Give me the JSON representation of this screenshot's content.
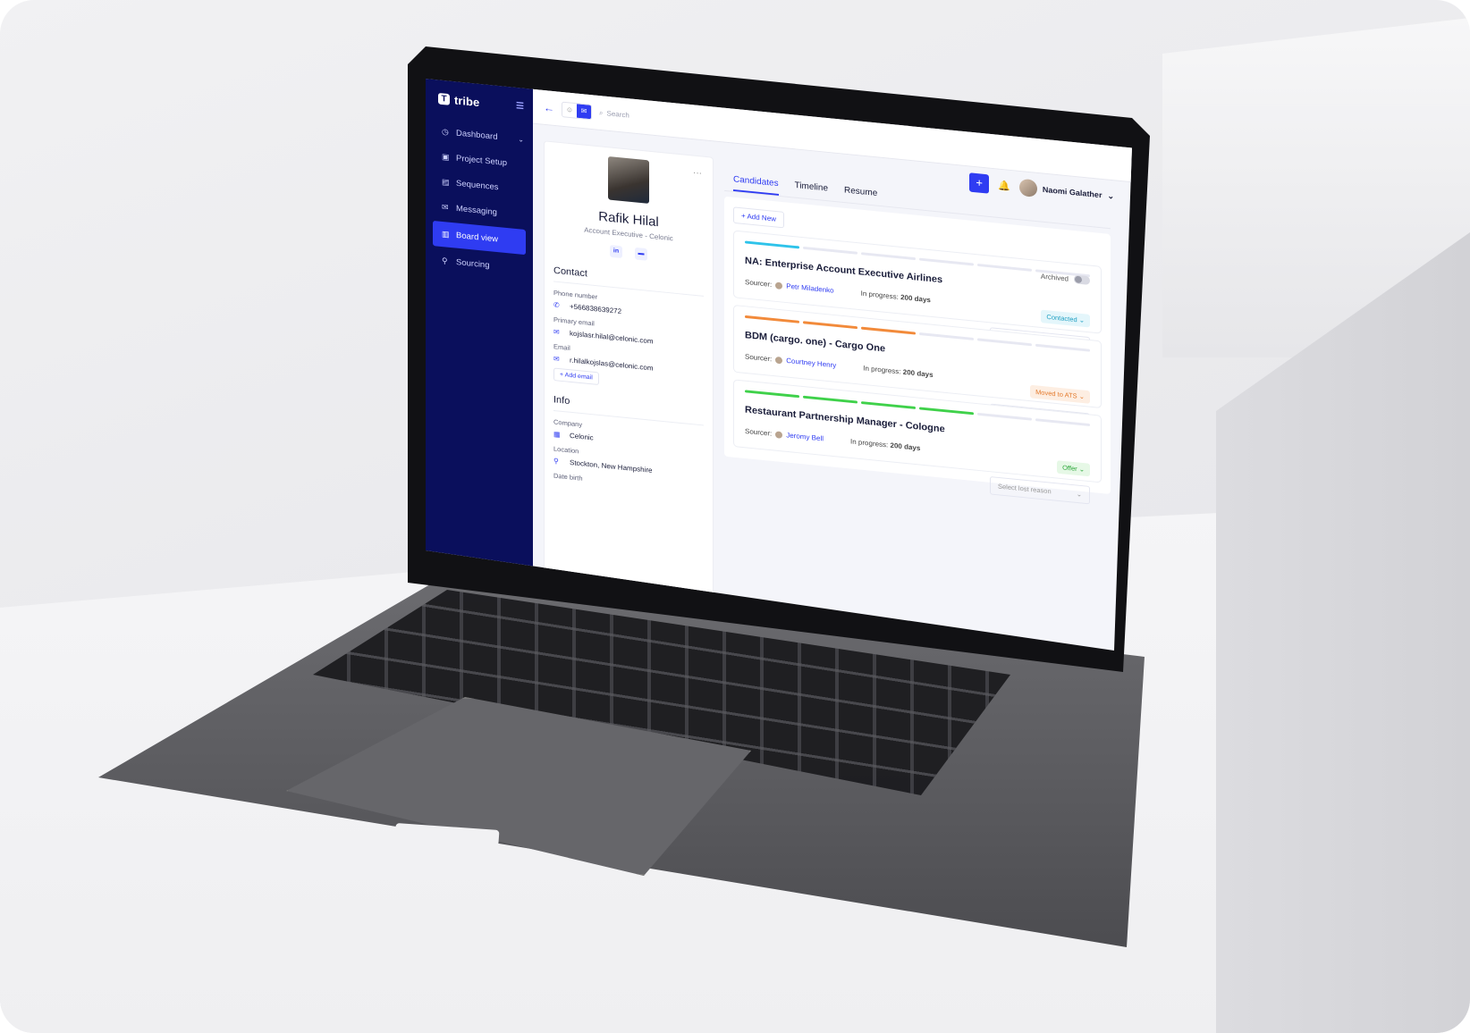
{
  "app": {
    "brand": "tribe",
    "nav": [
      {
        "label": "Dashboard",
        "icon": "clock-icon"
      },
      {
        "label": "Project Setup",
        "icon": "briefcase-icon"
      },
      {
        "label": "Sequences",
        "icon": "document-icon"
      },
      {
        "label": "Messaging",
        "icon": "mail-icon"
      },
      {
        "label": "Board view",
        "icon": "board-icon",
        "active": true
      },
      {
        "label": "Sourcing",
        "icon": "user-icon"
      }
    ],
    "search_placeholder": "Search",
    "user_name": "Naomi Galather"
  },
  "profile": {
    "name": "Rafik Hilal",
    "title": "Account Executive - Celonic",
    "contact_heading": "Contact",
    "phone_label": "Phone number",
    "phone": "+566838639272",
    "primary_email_label": "Primary email",
    "primary_email": "kojslasr.hilal@celonic.com",
    "email_label": "Email",
    "email": "r.hilalkojslas@celonic.com",
    "add_email": "Add email",
    "info_heading": "Info",
    "company_label": "Company",
    "company": "Celonic",
    "location_label": "Location",
    "location": "Stockton, New Hampshire",
    "dob_label": "Date birth"
  },
  "tabs": [
    "Candidates",
    "Timeline",
    "Resume"
  ],
  "add_new": "Add New",
  "archived_label": "Archived",
  "sourcer_label": "Sourcer:",
  "progress_label": "In progress:",
  "lost_placeholder": "Select lost reason",
  "cards": [
    {
      "title": "NA: Enterprise Account Executive Airlines",
      "sourcer": "Petr Miladenko",
      "days": "200 days",
      "status": "Contacted",
      "color": "#2ec3ea",
      "filled": 1
    },
    {
      "title": "BDM (cargo. one) - Cargo One",
      "sourcer": "Courtney Henry",
      "days": "200 days",
      "status": "Moved to ATS",
      "color": "#f28a3a",
      "filled": 3
    },
    {
      "title": "Restaurant Partnership Manager - Cologne",
      "sourcer": "Jeromy Bell",
      "days": "200 days",
      "status": "Offer",
      "color": "#3fd14a",
      "filled": 4
    }
  ]
}
